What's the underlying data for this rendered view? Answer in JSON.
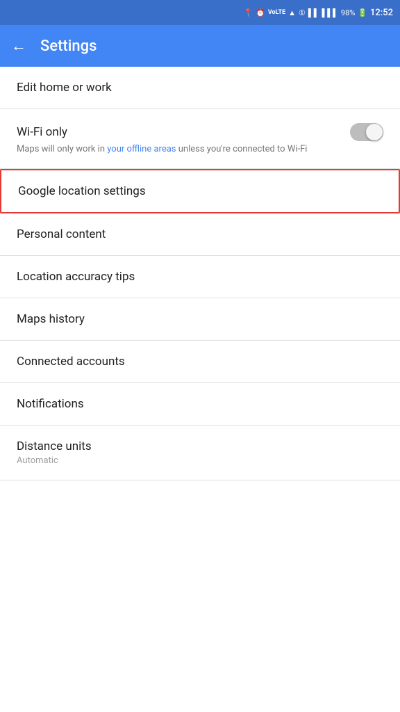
{
  "statusBar": {
    "battery": "98%",
    "time": "12:52",
    "icons": [
      "location",
      "alarm",
      "volte",
      "wifi",
      "notification",
      "signal1",
      "signal2",
      "battery"
    ]
  },
  "appBar": {
    "title": "Settings",
    "backArrow": "←"
  },
  "settingsItems": [
    {
      "id": "edit-home-work",
      "label": "Edit home or work",
      "type": "simple"
    },
    {
      "id": "wifi-only",
      "label": "Wi-Fi only",
      "subtext": "Maps will only work in your offline areas unless you're connected to Wi-Fi",
      "subtextLinkText": "your offline areas",
      "type": "toggle",
      "toggleOn": false
    },
    {
      "id": "google-location-settings",
      "label": "Google location settings",
      "type": "simple",
      "highlighted": true
    },
    {
      "id": "personal-content",
      "label": "Personal content",
      "type": "simple"
    },
    {
      "id": "location-accuracy-tips",
      "label": "Location accuracy tips",
      "type": "simple"
    },
    {
      "id": "maps-history",
      "label": "Maps history",
      "type": "simple"
    },
    {
      "id": "connected-accounts",
      "label": "Connected accounts",
      "type": "simple"
    },
    {
      "id": "notifications",
      "label": "Notifications",
      "type": "simple"
    },
    {
      "id": "distance-units",
      "label": "Distance units",
      "subtext": "Automatic",
      "type": "subtext"
    }
  ]
}
